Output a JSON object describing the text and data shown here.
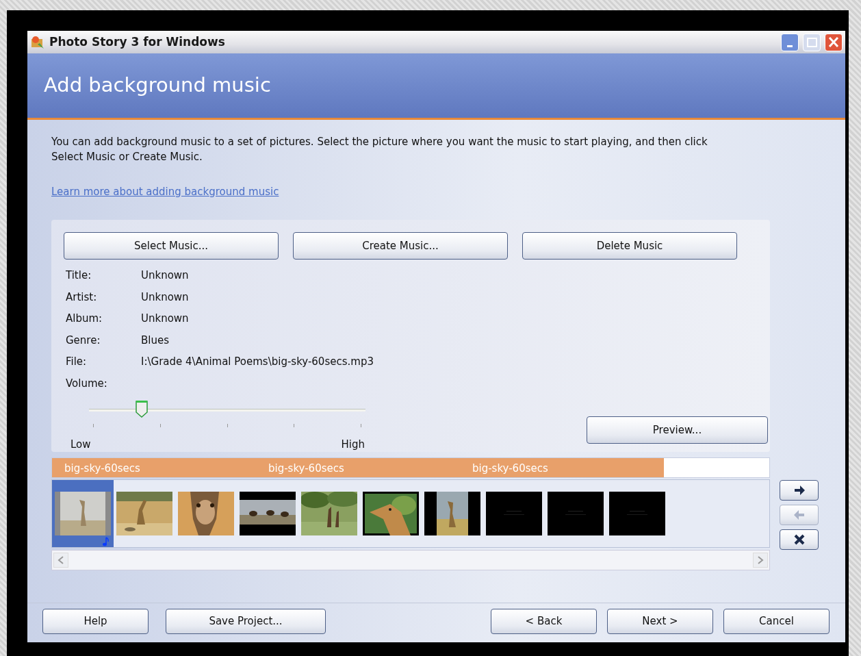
{
  "window": {
    "title": "Photo Story 3 for Windows"
  },
  "header": {
    "title": "Add background music"
  },
  "intro": "You can add background music to a set of pictures.  Select the picture where you want the music to start playing, and then click Select Music or Create Music.",
  "link": "Learn more about adding background music",
  "music_buttons": [
    "Select Music...",
    "Create Music...",
    "Delete Music"
  ],
  "details": [
    {
      "label": "Title:",
      "value": "Unknown"
    },
    {
      "label": "Artist:",
      "value": "Unknown"
    },
    {
      "label": "Album:",
      "value": "Unknown"
    },
    {
      "label": "Genre:",
      "value": "Blues"
    },
    {
      "label": "File:",
      "value": "I:\\Grade 4\\Animal Poems\\big-sky-60secs.mp3"
    }
  ],
  "volume": {
    "label": "Volume:",
    "level": 0.19,
    "low": "Low",
    "high": "High"
  },
  "preview_button": "Preview...",
  "timeline": {
    "music": [
      {
        "label": "big-sky-60secs"
      },
      {
        "label": "big-sky-60secs"
      },
      {
        "label": "big-sky-60secs"
      }
    ],
    "thumbnails": [
      {
        "selected": true,
        "has_music": true
      },
      {
        "selected": false,
        "has_music": false
      },
      {
        "selected": false,
        "has_music": false
      },
      {
        "selected": false,
        "has_music": false
      },
      {
        "selected": false,
        "has_music": false
      },
      {
        "selected": false,
        "has_music": false
      },
      {
        "selected": false,
        "has_music": false
      },
      {
        "selected": false,
        "has_music": false
      },
      {
        "selected": false,
        "has_music": false
      },
      {
        "selected": false,
        "has_music": false
      }
    ]
  },
  "side_buttons": [
    {
      "kind": "move-right",
      "disabled": false
    },
    {
      "kind": "move-left",
      "disabled": true
    },
    {
      "kind": "remove",
      "disabled": false
    }
  ],
  "footer": {
    "left_buttons": [
      "Help",
      "Save Project..."
    ],
    "right_buttons": [
      "< Back",
      "Next >",
      "Cancel"
    ]
  }
}
